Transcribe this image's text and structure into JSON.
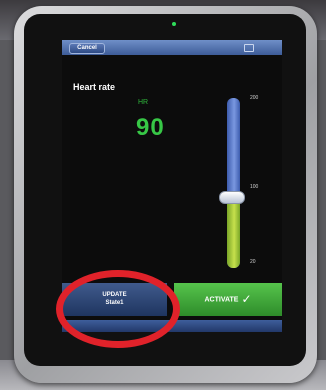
{
  "header": {
    "cancel_label": "Cancel",
    "center_text": "",
    "right_icon": "screen-icon"
  },
  "panel": {
    "title": "Heart rate",
    "metric_label": "HR",
    "value": "90"
  },
  "slider": {
    "max_label": "200",
    "mid_label": "100",
    "min_label": "20",
    "value": 90
  },
  "buttons": {
    "update_line1": "UPDATE",
    "update_line2": "State1",
    "activate_label": "ACTIVATE"
  },
  "colors": {
    "accent_green": "#37c746",
    "highlight_red": "#e0222a",
    "header_blue": "#3d5c98"
  }
}
